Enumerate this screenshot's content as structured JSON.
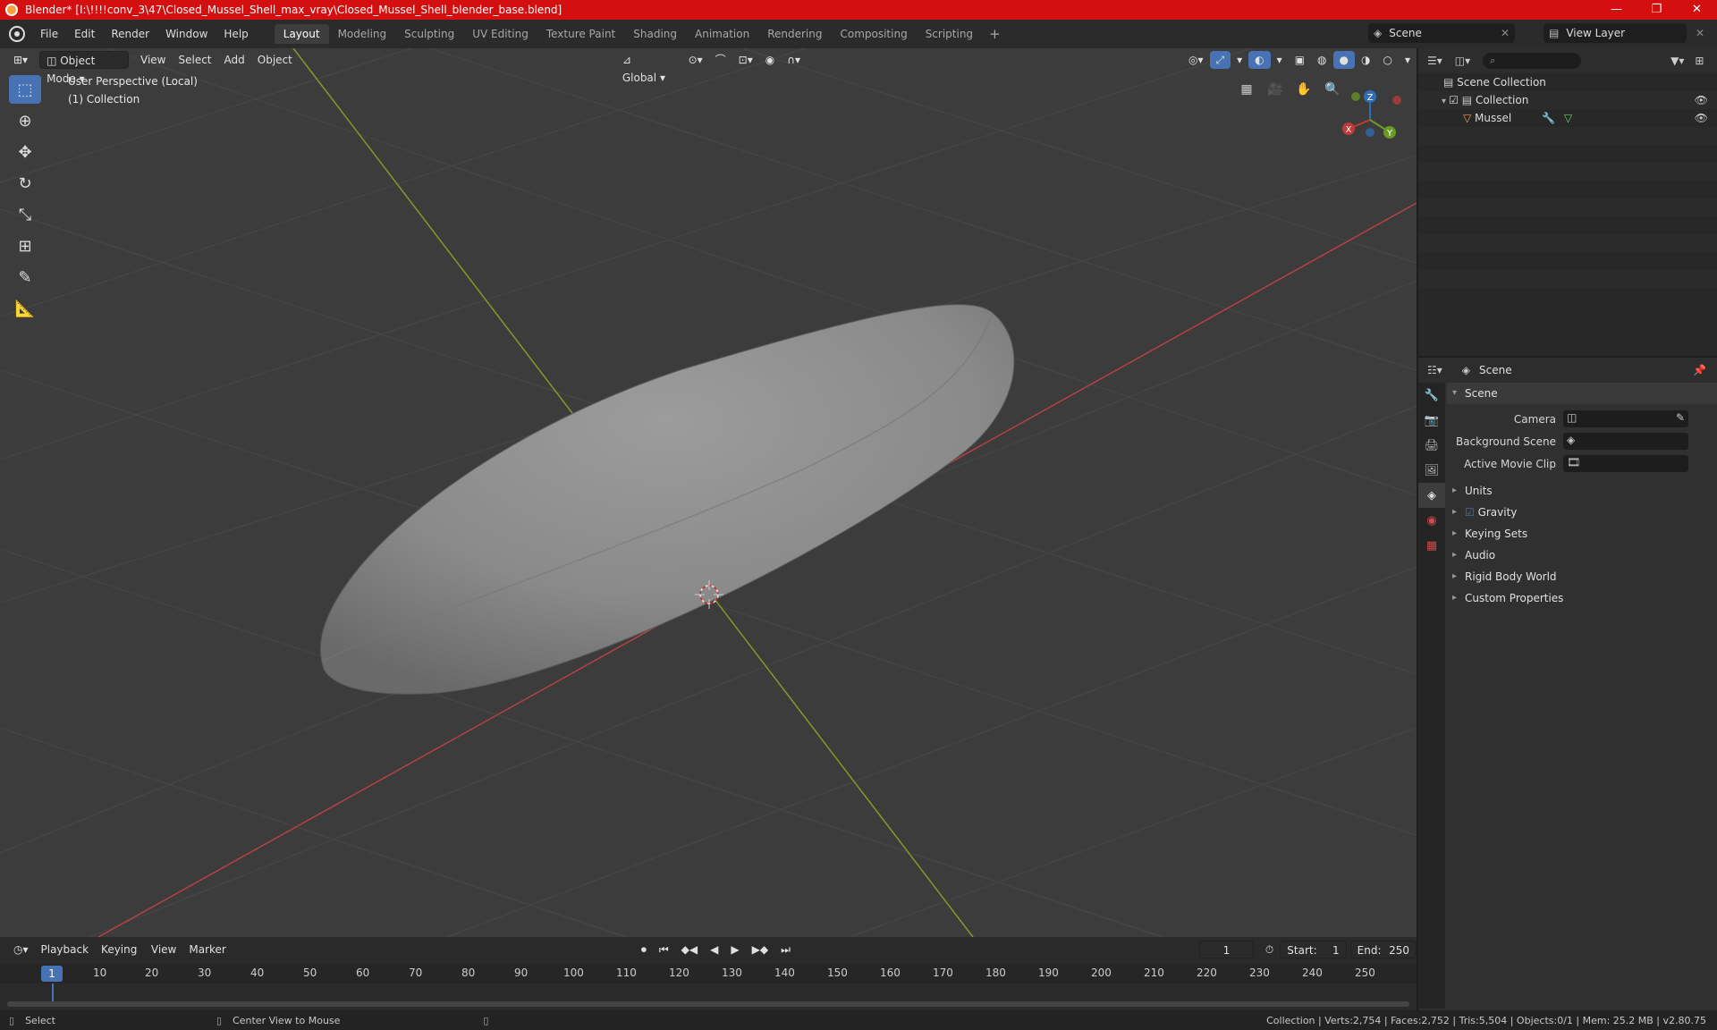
{
  "window": {
    "title": "Blender* [I:\\!!!!conv_3\\47\\Closed_Mussel_Shell_max_vray\\Closed_Mussel_Shell_blender_base.blend]",
    "minimize": "—",
    "maximize": "❐",
    "close": "✕"
  },
  "menu": [
    "File",
    "Edit",
    "Render",
    "Window",
    "Help"
  ],
  "workspaces": [
    "Layout",
    "Modeling",
    "Sculpting",
    "UV Editing",
    "Texture Paint",
    "Shading",
    "Animation",
    "Rendering",
    "Compositing",
    "Scripting"
  ],
  "workspace_add": "+",
  "scene_selector": "Scene",
  "view_layer_selector": "View Layer",
  "viewport": {
    "mode": "Object Mode",
    "menus": [
      "View",
      "Select",
      "Add",
      "Object"
    ],
    "orientation": "Global",
    "perspective_label": "User Perspective (Local)",
    "collection_label": "(1) Collection"
  },
  "gizmo": {
    "x": "X",
    "y": "Y",
    "z": "Z"
  },
  "outliner": {
    "root": "Scene Collection",
    "collection": "Collection",
    "object": "Mussel"
  },
  "properties": {
    "header": "Scene",
    "section": "Scene",
    "fields": [
      "Camera",
      "Background Scene",
      "Active Movie Clip"
    ],
    "subsections": [
      "Units",
      "Gravity",
      "Keying Sets",
      "Audio",
      "Rigid Body World",
      "Custom Properties"
    ]
  },
  "timeline": {
    "menus": [
      "Playback",
      "Keying",
      "View",
      "Marker"
    ],
    "current_frame": "1",
    "start_label": "Start:",
    "start": "1",
    "end_label": "End:",
    "end": "250",
    "ticks": [
      "1",
      "10",
      "20",
      "30",
      "40",
      "50",
      "60",
      "70",
      "80",
      "90",
      "100",
      "110",
      "120",
      "130",
      "140",
      "150",
      "160",
      "170",
      "180",
      "190",
      "200",
      "210",
      "220",
      "230",
      "240",
      "250"
    ]
  },
  "status": {
    "select": "Select",
    "center": "Center View to Mouse",
    "stats": "Collection | Verts:2,754 | Faces:2,752 | Tris:5,504 | Objects:0/1 | Mem: 25.2 MB | v2.80.75"
  }
}
